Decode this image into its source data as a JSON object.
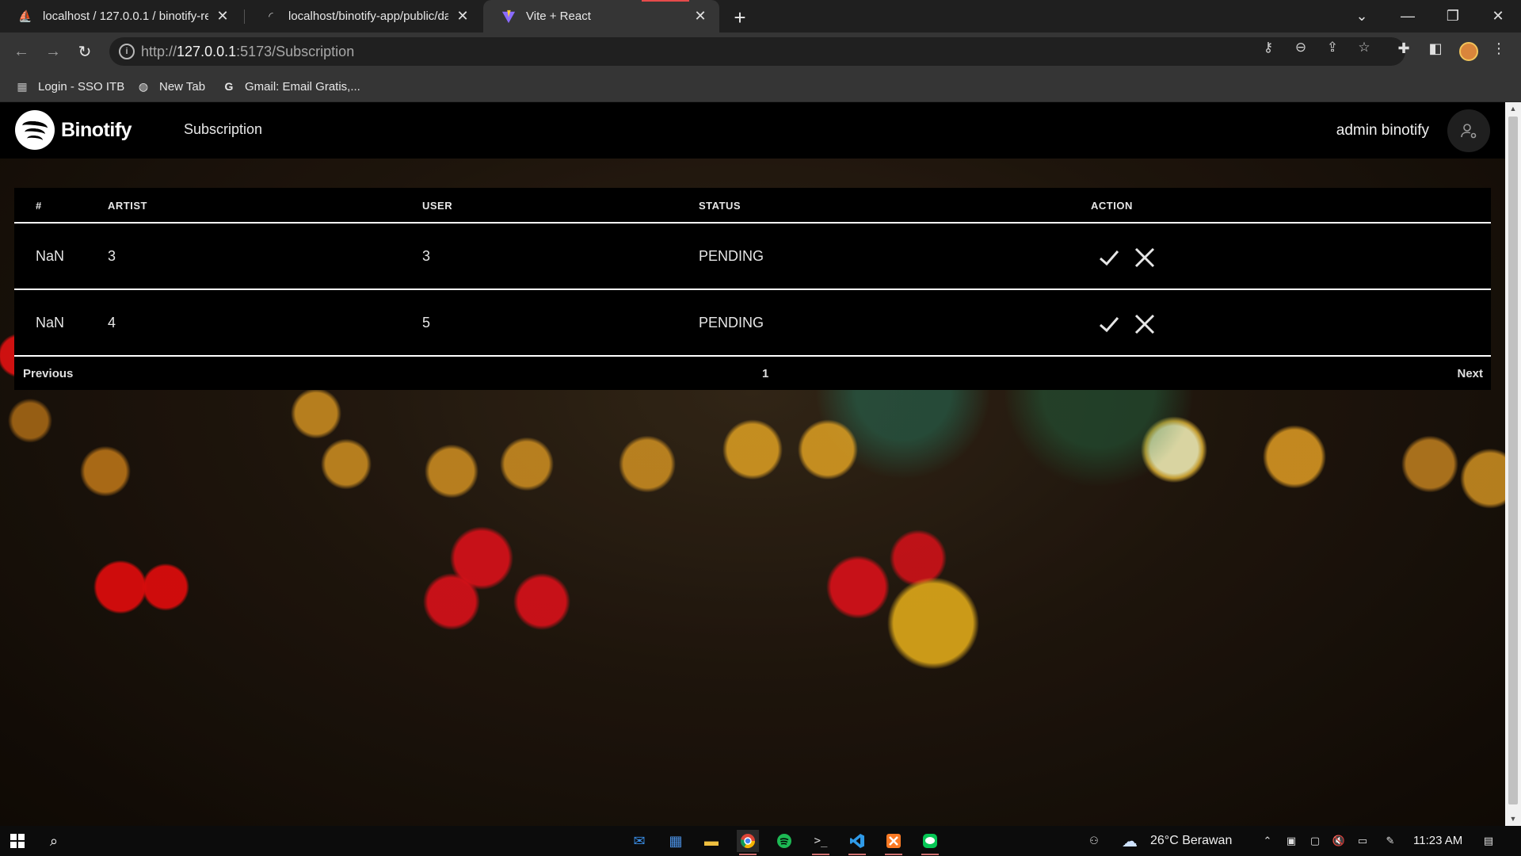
{
  "browser": {
    "tabs": [
      {
        "title": "localhost / 127.0.0.1 / binotify-re",
        "active": false
      },
      {
        "title": "localhost/binotify-app/public/da",
        "active": false
      },
      {
        "title": "Vite + React",
        "active": true
      }
    ],
    "address": {
      "scheme": "http://",
      "host": "127.0.0.1",
      "path": ":5173/Subscription"
    },
    "bookmarks": [
      {
        "label": "Login - SSO ITB",
        "icon": "sso-icon"
      },
      {
        "label": "New Tab",
        "icon": "globe-icon"
      },
      {
        "label": "Gmail: Email Gratis,...",
        "icon": "google-icon"
      }
    ]
  },
  "app": {
    "brand": "Binotify",
    "nav_link": "Subscription",
    "username": "admin binotify"
  },
  "table": {
    "columns": [
      "#",
      "ARTIST",
      "USER",
      "STATUS",
      "ACTION"
    ],
    "rows": [
      {
        "id": "NaN",
        "artist": "3",
        "user": "3",
        "status": "PENDING"
      },
      {
        "id": "NaN",
        "artist": "4",
        "user": "5",
        "status": "PENDING"
      }
    ],
    "pagination": {
      "previous": "Previous",
      "page": "1",
      "next": "Next"
    }
  },
  "taskbar": {
    "weather": "26°C Berawan",
    "time": "11:23 AM"
  },
  "colors": {
    "app_bg": "#000000",
    "accent_loading": "#e64b4b"
  }
}
